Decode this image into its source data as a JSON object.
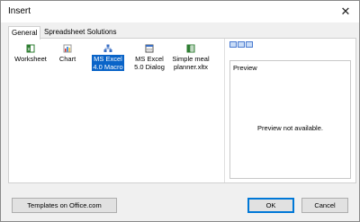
{
  "window": {
    "title": "Insert",
    "close_label": "✕"
  },
  "tabs": [
    {
      "label": "General",
      "active": true
    },
    {
      "label": "Spreadsheet Solutions",
      "active": false
    }
  ],
  "files": [
    {
      "line1": "Worksheet",
      "line2": "",
      "icon": "worksheet-icon",
      "selected": false
    },
    {
      "line1": "Chart",
      "line2": "",
      "icon": "chart-icon",
      "selected": false
    },
    {
      "line1": "MS Excel",
      "line2": "4.0 Macro",
      "icon": "macro-icon",
      "selected": true
    },
    {
      "line1": "MS Excel",
      "line2": "5.0 Dialog",
      "icon": "dialog-icon",
      "selected": false
    },
    {
      "line1": "Simple meal",
      "line2": "planner.xltx",
      "icon": "template-icon",
      "selected": false
    }
  ],
  "preview": {
    "label": "Preview",
    "message": "Preview not available."
  },
  "buttons": {
    "templates": "Templates on Office.com",
    "ok": "OK",
    "cancel": "Cancel"
  },
  "colors": {
    "selection": "#0a64c8",
    "accent": "#0078d7"
  }
}
